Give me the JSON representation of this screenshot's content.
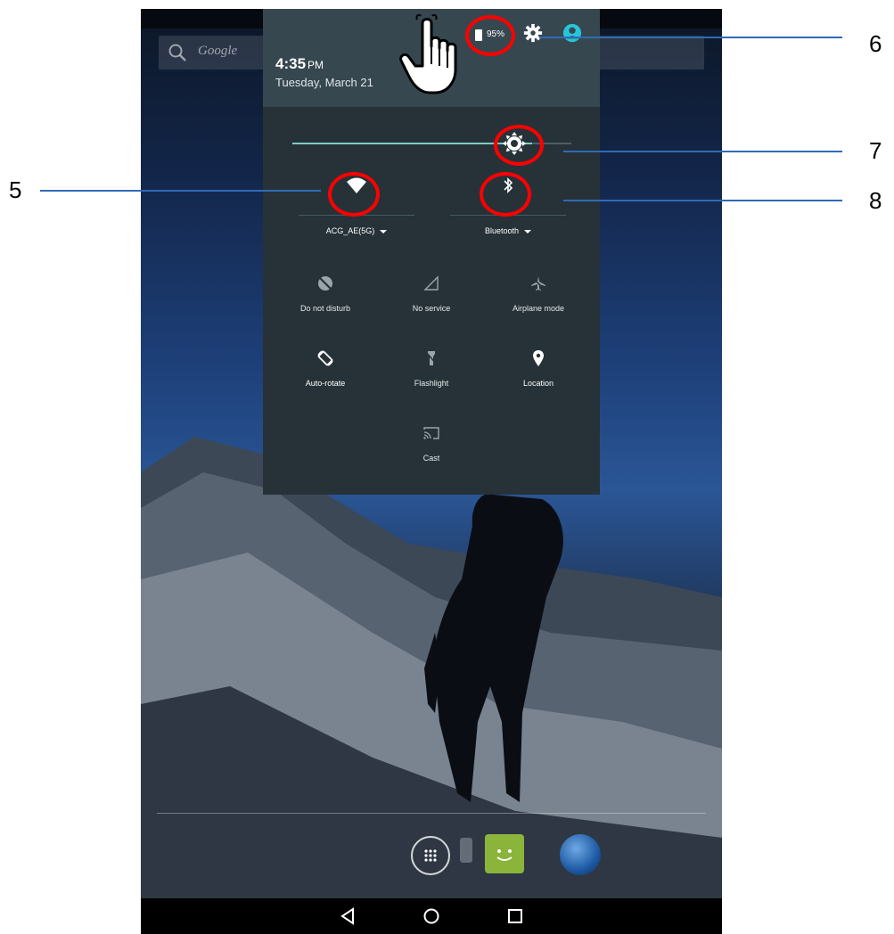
{
  "search": {
    "placeholder": "Google"
  },
  "quick_settings": {
    "time": "4:35",
    "time_suffix": "PM",
    "date": "Tuesday, March 21",
    "battery": "95%",
    "brightness_level": 0.86,
    "wifi": {
      "label": "ACG_AE(5G)"
    },
    "bluetooth": {
      "label": "Bluetooth"
    },
    "tiles": {
      "dnd": "Do not disturb",
      "no_service": "No service",
      "airplane": "Airplane mode",
      "auto_rotate": "Auto-rotate",
      "flashlight": "Flashlight",
      "location": "Location",
      "cast": "Cast"
    }
  },
  "annotations": {
    "n5": "5",
    "n6": "6",
    "n7": "7",
    "n8": "8",
    "color": "#ff0000",
    "line_color": "#2f6bb5"
  },
  "icons": [
    "search-icon",
    "battery-icon",
    "gear-icon",
    "account-icon",
    "brightness-icon",
    "wifi-icon",
    "bluetooth-icon",
    "do-not-disturb-icon",
    "no-service-icon",
    "airplane-mode-icon",
    "auto-rotate-icon",
    "flashlight-icon",
    "location-icon",
    "cast-icon",
    "hand-pointer-icon",
    "back-icon",
    "home-icon",
    "recents-icon"
  ]
}
